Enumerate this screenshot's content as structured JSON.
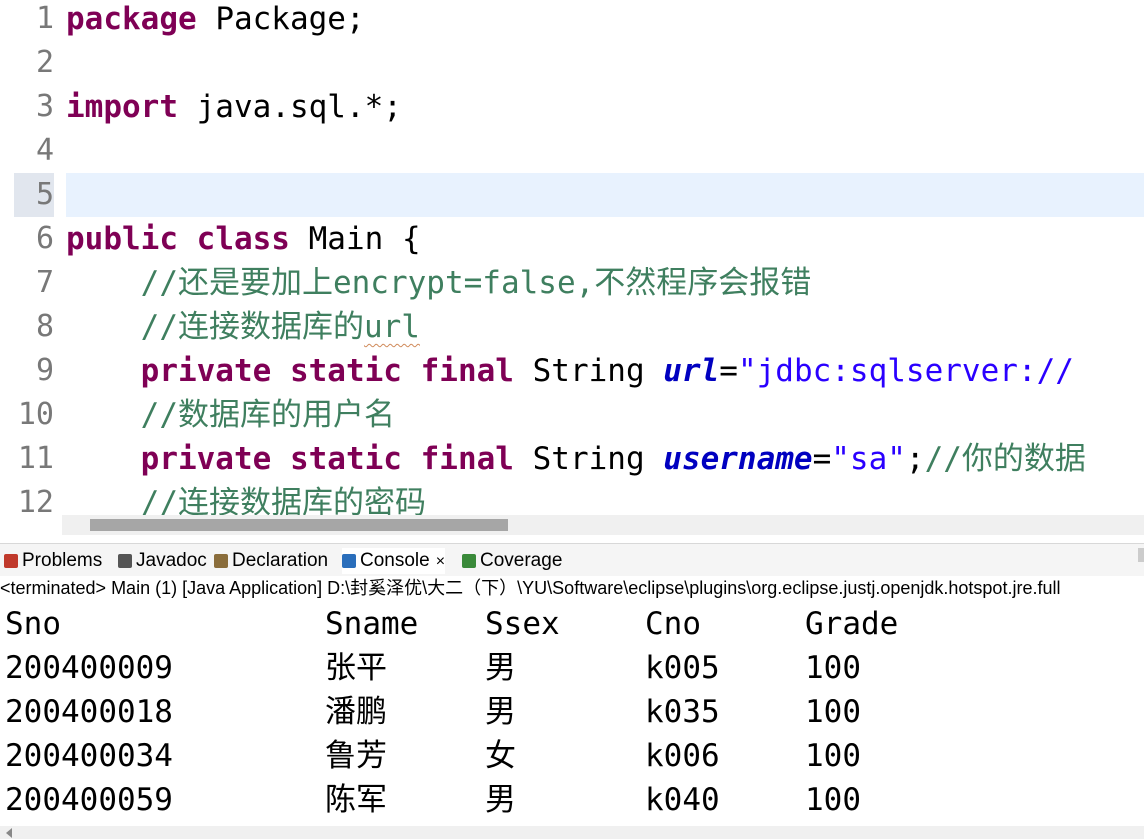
{
  "editor": {
    "lines": [
      {
        "no": "1",
        "tokens": [
          {
            "t": "package",
            "c": "kw"
          },
          {
            "t": " Package;",
            "c": ""
          }
        ]
      },
      {
        "no": "2",
        "tokens": []
      },
      {
        "no": "3",
        "tokens": [
          {
            "t": "import",
            "c": "kw"
          },
          {
            "t": " java.sql.*;",
            "c": ""
          }
        ]
      },
      {
        "no": "4",
        "tokens": []
      },
      {
        "no": "5",
        "tokens": [],
        "current": true
      },
      {
        "no": "6",
        "tokens": [
          {
            "t": "public",
            "c": "kw"
          },
          {
            "t": " ",
            "c": ""
          },
          {
            "t": "class",
            "c": "kw"
          },
          {
            "t": " Main {",
            "c": ""
          }
        ]
      },
      {
        "no": "7",
        "tokens": [
          {
            "t": "    ",
            "c": ""
          },
          {
            "t": "//还是要加上encrypt=false,不然程序会报错",
            "c": "cm"
          }
        ]
      },
      {
        "no": "8",
        "tokens": [
          {
            "t": "    ",
            "c": ""
          },
          {
            "t": "//连接数据库的",
            "c": "cm"
          },
          {
            "t": "url",
            "c": "cm squig"
          }
        ]
      },
      {
        "no": "9",
        "tokens": [
          {
            "t": "    ",
            "c": ""
          },
          {
            "t": "private",
            "c": "kw"
          },
          {
            "t": " ",
            "c": ""
          },
          {
            "t": "static",
            "c": "kw"
          },
          {
            "t": " ",
            "c": ""
          },
          {
            "t": "final",
            "c": "kw"
          },
          {
            "t": " String ",
            "c": ""
          },
          {
            "t": "url",
            "c": "fld"
          },
          {
            "t": "=",
            "c": ""
          },
          {
            "t": "\"jdbc:sqlserver://",
            "c": "str"
          }
        ]
      },
      {
        "no": "10",
        "tokens": [
          {
            "t": "    ",
            "c": ""
          },
          {
            "t": "//数据库的用户名",
            "c": "cm"
          }
        ]
      },
      {
        "no": "11",
        "tokens": [
          {
            "t": "    ",
            "c": ""
          },
          {
            "t": "private",
            "c": "kw"
          },
          {
            "t": " ",
            "c": ""
          },
          {
            "t": "static",
            "c": "kw"
          },
          {
            "t": " ",
            "c": ""
          },
          {
            "t": "final",
            "c": "kw"
          },
          {
            "t": " String ",
            "c": ""
          },
          {
            "t": "username",
            "c": "fld"
          },
          {
            "t": "=",
            "c": ""
          },
          {
            "t": "\"sa\"",
            "c": "str"
          },
          {
            "t": ";",
            "c": ""
          },
          {
            "t": "//你的数据",
            "c": "cm"
          }
        ]
      },
      {
        "no": "12",
        "tokens": [
          {
            "t": "    ",
            "c": ""
          },
          {
            "t": "//连接数据库的密码",
            "c": "cm"
          }
        ]
      }
    ]
  },
  "panel": {
    "tabs": [
      {
        "label": "Problems",
        "icon": "problems-icon",
        "color": "#c0392b"
      },
      {
        "label": "Javadoc",
        "icon": "javadoc-icon",
        "color": "#555555"
      },
      {
        "label": "Declaration",
        "icon": "declaration-icon",
        "color": "#8a6d3b"
      },
      {
        "label": "Console",
        "icon": "console-icon",
        "color": "#2a6ebb",
        "active": true,
        "close": "×"
      },
      {
        "label": "Coverage",
        "icon": "coverage-icon",
        "color": "#3a8a3a"
      }
    ],
    "status": "<terminated> Main (1) [Java Application] D:\\封奚泽优\\大二（下）\\YU\\Software\\eclipse\\plugins\\org.eclipse.justj.openjdk.hotspot.jre.full"
  },
  "console": {
    "headers": [
      "Sno",
      "Sname",
      "Ssex",
      "Cno",
      "Grade"
    ],
    "rows": [
      [
        "200400009",
        "张平",
        "男",
        "k005",
        "100"
      ],
      [
        "200400018",
        "潘鹏",
        "男",
        "k035",
        "100"
      ],
      [
        "200400034",
        "鲁芳",
        "女",
        "k006",
        "100"
      ],
      [
        "200400059",
        "陈军",
        "男",
        "k040",
        "100"
      ]
    ]
  }
}
